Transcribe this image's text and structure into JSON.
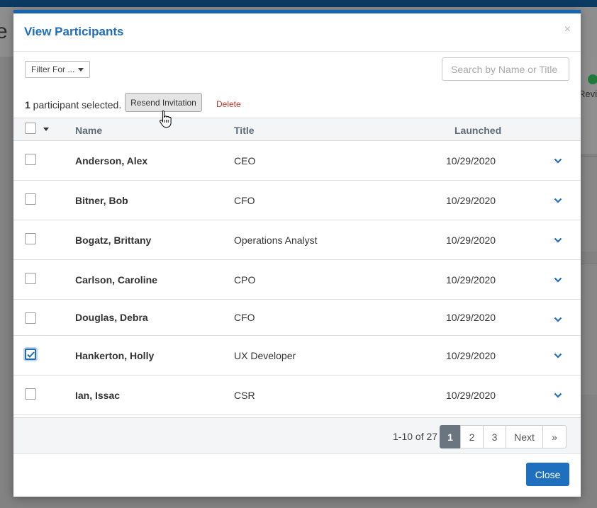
{
  "background": {
    "left_letter": "e",
    "right_text": "Revie"
  },
  "modal": {
    "title": "View Participants",
    "close_icon": "×",
    "filter_label": "Filter For ...",
    "search_placeholder": "Search by Name or Title",
    "selected_count": "1",
    "selected_text": " participant selected.",
    "resend_label": "Resend Invitation",
    "delete_label": "Delete"
  },
  "table": {
    "columns": {
      "name": "Name",
      "title": "Title",
      "launched": "Launched"
    },
    "rows": [
      {
        "name": "Anderson, Alex",
        "title": "CEO",
        "launched": "10/29/2020",
        "checked": false
      },
      {
        "name": "Bitner, Bob",
        "title": "CFO",
        "launched": "10/29/2020",
        "checked": false
      },
      {
        "name": "Bogatz, Brittany",
        "title": "Operations Analyst",
        "launched": "10/29/2020",
        "checked": false
      },
      {
        "name": "Carlson, Caroline",
        "title": "CPO",
        "launched": "10/29/2020",
        "checked": false
      },
      {
        "name": "Douglas, Debra",
        "title": "CFO",
        "launched": "10/29/2020",
        "checked": false
      },
      {
        "name": "Hankerton, Holly",
        "title": "UX Developer",
        "launched": "10/29/2020",
        "checked": true
      },
      {
        "name": "Ian, Issac",
        "title": "CSR",
        "launched": "10/29/2020",
        "checked": false
      }
    ]
  },
  "pagination": {
    "info": "1-10 of 27",
    "pages": [
      "1",
      "2",
      "3"
    ],
    "active": "1",
    "next_label": "Next",
    "last_label": "»"
  },
  "footer": {
    "close_label": "Close"
  },
  "colors": {
    "accent": "#1e6db8",
    "delete": "#c0392b",
    "active_page": "#6b7580",
    "close_button": "#1f6fbf"
  }
}
